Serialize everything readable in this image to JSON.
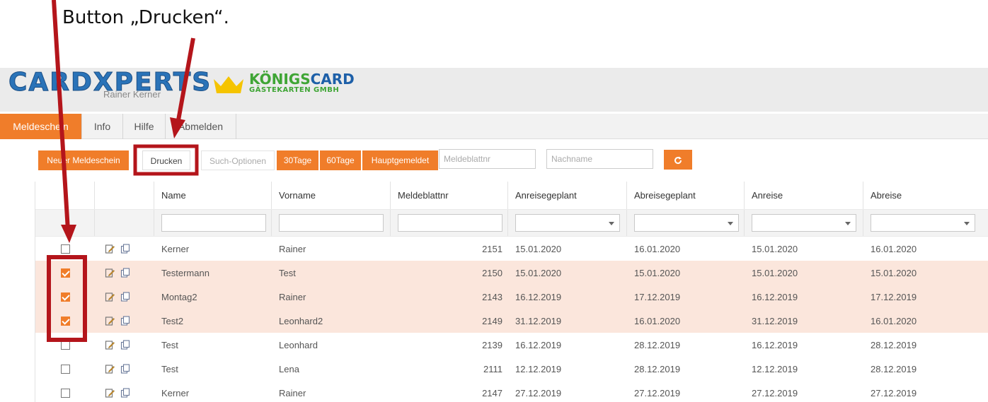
{
  "caption": "Button „Drucken“.",
  "logo": {
    "cardxperts": "CARDXPERTS",
    "subtitle": "Rainer Kerner",
    "koenigs_a": "KÖNIGS",
    "koenigs_b": "CARD",
    "gaestekarten": "GÄSTEKARTEN GMBH"
  },
  "nav": [
    "Meldeschein",
    "Info",
    "Hilfe",
    "Abmelden"
  ],
  "toolbar": {
    "new_label": "Neuer Meldeschein",
    "print_label": "Drucken",
    "search_options_label": "Such-Optionen",
    "days30_label": "30Tage",
    "days60_label": "60Tage",
    "main_reported_label": "Hauptgemeldet",
    "meldeblatt_placeholder": "Meldeblattnr",
    "lastname_placeholder": "Nachname",
    "refresh_icon": "refresh-icon"
  },
  "columns": [
    "Name",
    "Vorname",
    "Meldeblattnr",
    "Anreisegeplant",
    "Abreisegeplant",
    "Anreise",
    "Abreise"
  ],
  "rows": [
    {
      "checked": false,
      "name": "Kerner",
      "vorname": "Rainer",
      "nr": "2151",
      "anreise_geplant": "15.01.2020",
      "abreise_geplant": "16.01.2020",
      "anreise": "15.01.2020",
      "abreise": "16.01.2020"
    },
    {
      "checked": true,
      "name": "Testermann",
      "vorname": "Test",
      "nr": "2150",
      "anreise_geplant": "15.01.2020",
      "abreise_geplant": "15.01.2020",
      "anreise": "15.01.2020",
      "abreise": "15.01.2020"
    },
    {
      "checked": true,
      "name": "Montag2",
      "vorname": "Rainer",
      "nr": "2143",
      "anreise_geplant": "16.12.2019",
      "abreise_geplant": "17.12.2019",
      "anreise": "16.12.2019",
      "abreise": "17.12.2019"
    },
    {
      "checked": true,
      "name": "Test2",
      "vorname": "Leonhard2",
      "nr": "2149",
      "anreise_geplant": "31.12.2019",
      "abreise_geplant": "16.01.2020",
      "anreise": "31.12.2019",
      "abreise": "16.01.2020"
    },
    {
      "checked": false,
      "name": "Test",
      "vorname": "Leonhard",
      "nr": "2139",
      "anreise_geplant": "16.12.2019",
      "abreise_geplant": "28.12.2019",
      "anreise": "16.12.2019",
      "abreise": "28.12.2019"
    },
    {
      "checked": false,
      "name": "Test",
      "vorname": "Lena",
      "nr": "2111",
      "anreise_geplant": "12.12.2019",
      "abreise_geplant": "28.12.2019",
      "anreise": "12.12.2019",
      "abreise": "28.12.2019"
    },
    {
      "checked": false,
      "name": "Kerner",
      "vorname": "Rainer",
      "nr": "2147",
      "anreise_geplant": "27.12.2019",
      "abreise_geplant": "27.12.2019",
      "anreise": "27.12.2019",
      "abreise": "27.12.2019"
    }
  ],
  "colors": {
    "accent": "#f07d2a",
    "selected_row": "#fbe6dc",
    "annotation": "#b4151b"
  }
}
